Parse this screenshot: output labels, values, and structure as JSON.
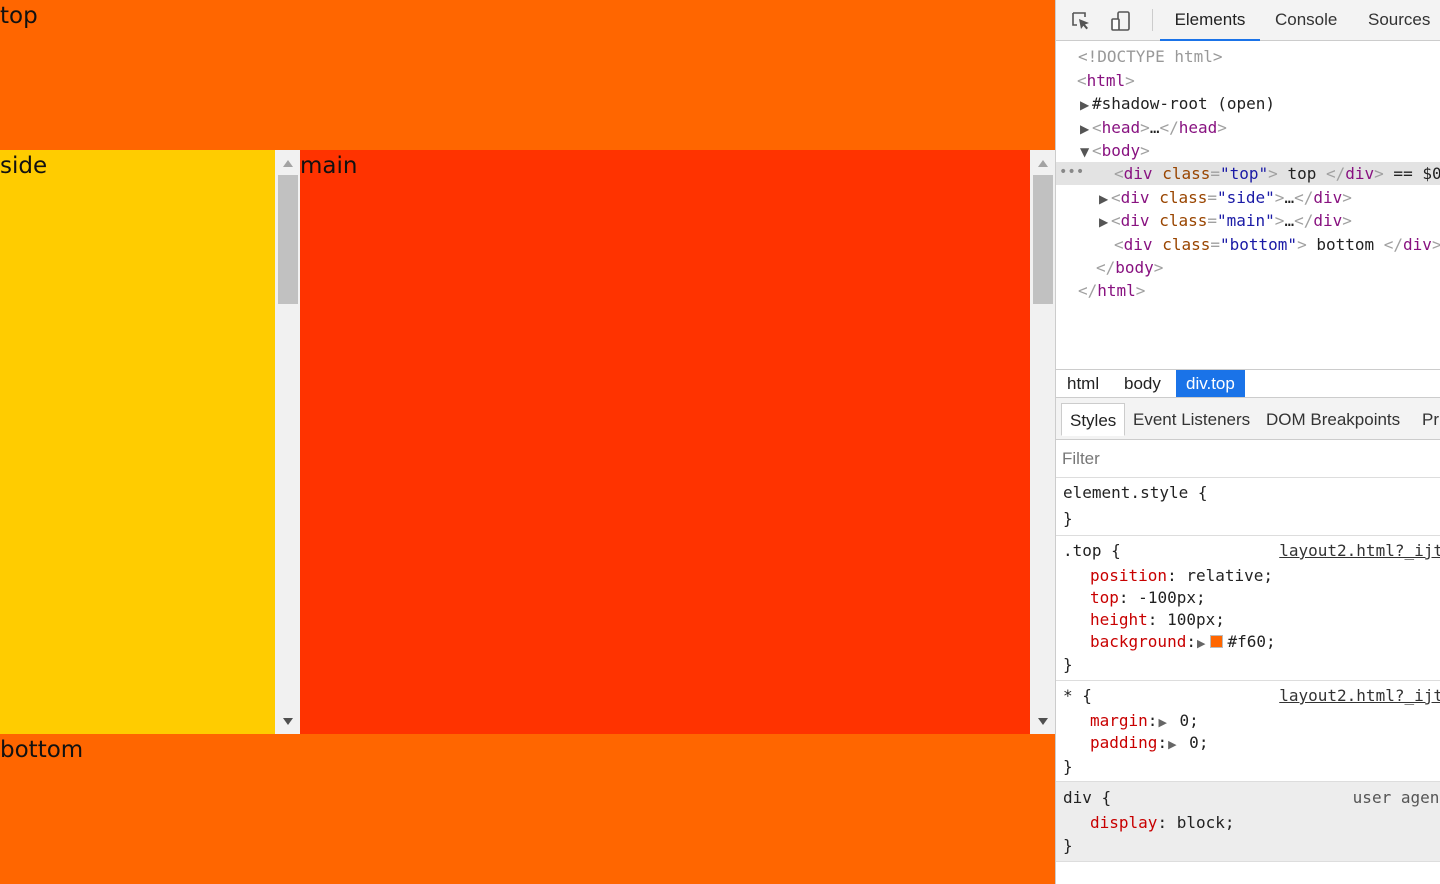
{
  "page": {
    "top_label": "top",
    "side_label": "side",
    "main_label": "main",
    "bottom_label": "bottom",
    "colors": {
      "top": "#ff6600",
      "side": "#ffcc00",
      "main": "#ff3300",
      "bottom": "#ff6600"
    }
  },
  "devtools": {
    "toolbar": {
      "icons": [
        "inspect-element-icon",
        "device-toggle-icon"
      ],
      "tabs": [
        "Elements",
        "Console",
        "Sources"
      ],
      "active_tab": "Elements"
    },
    "dom": {
      "doctype": "<!DOCTYPE html>",
      "html_open": "html",
      "shadow_root": "#shadow-root (open)",
      "head_tag": "head",
      "head_ellipsis": "…",
      "body_tag": "body",
      "div_tag": "div",
      "class_attr": "class",
      "top_class": "\"top\"",
      "top_text": " top ",
      "selected_marker": " == $0",
      "side_class": "\"side\"",
      "main_class": "\"main\"",
      "bottom_class": "\"bottom\"",
      "bottom_text": " bottom ",
      "ellipsis": "…"
    },
    "breadcrumbs": [
      "html",
      "body",
      "div.top"
    ],
    "sub_tabs": [
      "Styles",
      "Event Listeners",
      "DOM Breakpoints",
      "Pr"
    ],
    "filter_placeholder": "Filter",
    "styles": {
      "element_style": "element.style {",
      "close_brace": "}",
      "top_rule": {
        "selector": ".top {",
        "source": "layout2.html?_ijt",
        "position_prop": "position",
        "position_val": " relative;",
        "top_prop": "top",
        "top_val": " -100px;",
        "height_prop": "height",
        "height_val": " 100px;",
        "background_prop": "background",
        "background_val": "#f60;",
        "swatch_color": "#ff6600"
      },
      "star_rule": {
        "selector": "* {",
        "source": "layout2.html?_ijt",
        "margin_prop": "margin",
        "margin_val": " 0;",
        "padding_prop": "padding",
        "padding_val": " 0;"
      },
      "div_rule": {
        "selector": "div {",
        "source": "user agent",
        "display_prop": "display",
        "display_val": " block;"
      }
    }
  }
}
